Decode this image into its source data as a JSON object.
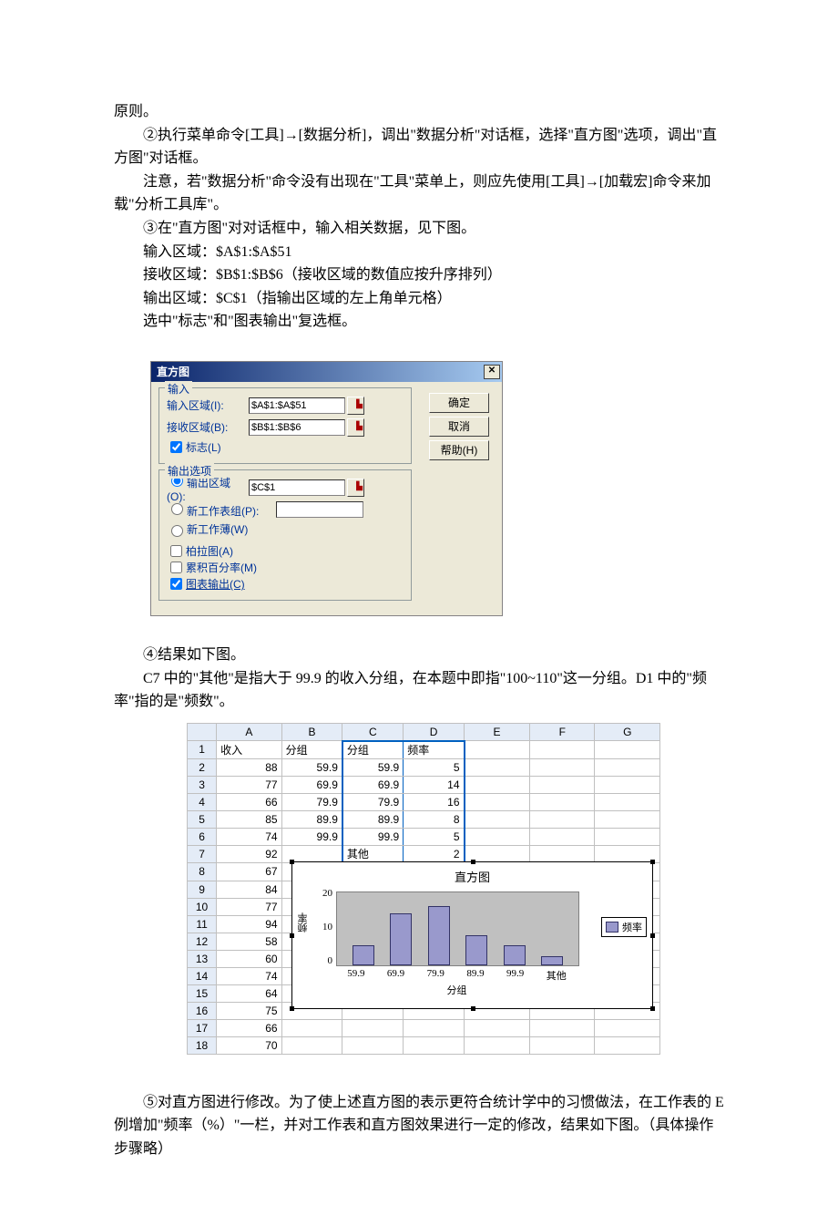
{
  "text": {
    "p1": "原则。",
    "p2": "②执行菜单命令[工具]→[数据分析]，调出\"数据分析\"对话框，选择\"直方图\"选项，调出\"直方图\"对话框。",
    "p3": "注意，若\"数据分析\"命令没有出现在\"工具\"菜单上，则应先使用[工具]→[加载宏]命令来加载\"分析工具库\"。",
    "p4": "③在\"直方图\"对对话框中，输入相关数据，见下图。",
    "p5": "输入区域：$A$1:$A$51",
    "p6": "接收区域：$B$1:$B$6（接收区域的数值应按升序排列）",
    "p7": "输出区域：$C$1（指输出区域的左上角单元格）",
    "p8": "选中\"标志\"和\"图表输出\"复选框。",
    "p9": "④结果如下图。",
    "p10": "C7 中的\"其他\"是指大于 99.9 的收入分组，在本题中即指\"100~110\"这一分组。D1 中的\"频率\"指的是\"频数\"。",
    "p11": "⑤对直方图进行修改。为了使上述直方图的表示更符合统计学中的习惯做法，在工作表的 E 例增加\"频率（%）\"一栏，并对工作表和直方图效果进行一定的修改，结果如下图。（具体操作步骤略）"
  },
  "dialog": {
    "title": "直方图",
    "close": "✕",
    "grp_input": "输入",
    "lbl_input_range": "输入区域(I):",
    "val_input_range": "$A$1:$A$51",
    "lbl_bin_range": "接收区域(B):",
    "val_bin_range": "$B$1:$B$6",
    "lbl_labels": "标志(L)",
    "grp_output": "输出选项",
    "lbl_out_range": "输出区域(O):",
    "val_out_range": "$C$1",
    "lbl_new_ws": "新工作表组(P):",
    "lbl_new_wb": "新工作薄(W)",
    "lbl_pareto": "柏拉图(A)",
    "lbl_cum": "累积百分率(M)",
    "lbl_chart_out": "图表输出(C)",
    "btn_ok": "确定",
    "btn_cancel": "取消",
    "btn_help": "帮助(H)"
  },
  "sheet": {
    "cols": [
      "A",
      "B",
      "C",
      "D",
      "E",
      "F",
      "G"
    ],
    "h_a": "收入",
    "h_b": "分组",
    "h_c": "分组",
    "h_d": "频率",
    "rows": [
      {
        "n": "1"
      },
      {
        "n": "2",
        "a": "88",
        "b": "59.9",
        "c": "59.9",
        "d": "5"
      },
      {
        "n": "3",
        "a": "77",
        "b": "69.9",
        "c": "69.9",
        "d": "14"
      },
      {
        "n": "4",
        "a": "66",
        "b": "79.9",
        "c": "79.9",
        "d": "16"
      },
      {
        "n": "5",
        "a": "85",
        "b": "89.9",
        "c": "89.9",
        "d": "8"
      },
      {
        "n": "6",
        "a": "74",
        "b": "99.9",
        "c": "99.9",
        "d": "5"
      },
      {
        "n": "7",
        "a": "92",
        "b": "",
        "c": "其他",
        "d": "2"
      },
      {
        "n": "8",
        "a": "67"
      },
      {
        "n": "9",
        "a": "84"
      },
      {
        "n": "10",
        "a": "77"
      },
      {
        "n": "11",
        "a": "94"
      },
      {
        "n": "12",
        "a": "58"
      },
      {
        "n": "13",
        "a": "60"
      },
      {
        "n": "14",
        "a": "74"
      },
      {
        "n": "15",
        "a": "64"
      },
      {
        "n": "16",
        "a": "75"
      },
      {
        "n": "17",
        "a": "66"
      },
      {
        "n": "18",
        "a": "70"
      }
    ]
  },
  "chart_data": {
    "type": "bar",
    "title": "直方图",
    "xlabel": "分组",
    "ylabel": "频率",
    "categories": [
      "59.9",
      "69.9",
      "79.9",
      "89.9",
      "99.9",
      "其他"
    ],
    "values": [
      5,
      14,
      16,
      8,
      5,
      2
    ],
    "yticks": [
      "20",
      "10",
      "0"
    ],
    "ylim": [
      0,
      20
    ],
    "legend": "频率"
  }
}
